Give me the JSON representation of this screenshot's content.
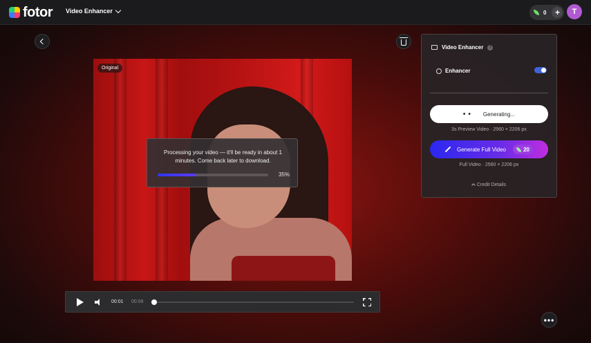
{
  "header": {
    "brand": "fotor",
    "tool_menu_label": "Video Enhancer",
    "credits_count": "0",
    "avatar_letter": "T"
  },
  "video": {
    "tag_label": "Original"
  },
  "processing": {
    "message": "Processing your video — it'll be ready in about 1 minutes. Come back later to download.",
    "progress_percent": 35,
    "progress_label": "35%"
  },
  "player": {
    "current_time": "00:01",
    "total_time": "00:08",
    "seek_fraction": 0.125
  },
  "panel": {
    "title": "Video Enhancer",
    "enhancer_label": "Enhancer",
    "enhancer_enabled": true,
    "generating_label": "Generating...",
    "preview_info": "3s Preview Video · 2560 × 2206 px",
    "generate_full_label": "Generate Full Video",
    "generate_full_cost": "20",
    "full_info": "Full Video · 2560 × 2206 px",
    "credit_details_label": "Credit Details"
  },
  "icons": {
    "back": "chevron-left-icon",
    "trash": "trash-icon",
    "more": "more-dots-icon",
    "help": "help-icon",
    "credit": "leaf-icon"
  },
  "colors": {
    "accent_blue": "#2f35ff",
    "gradient_purple": "#c02de0",
    "avatar": "#b25ad1",
    "credit_green": "#6fdc6a"
  }
}
